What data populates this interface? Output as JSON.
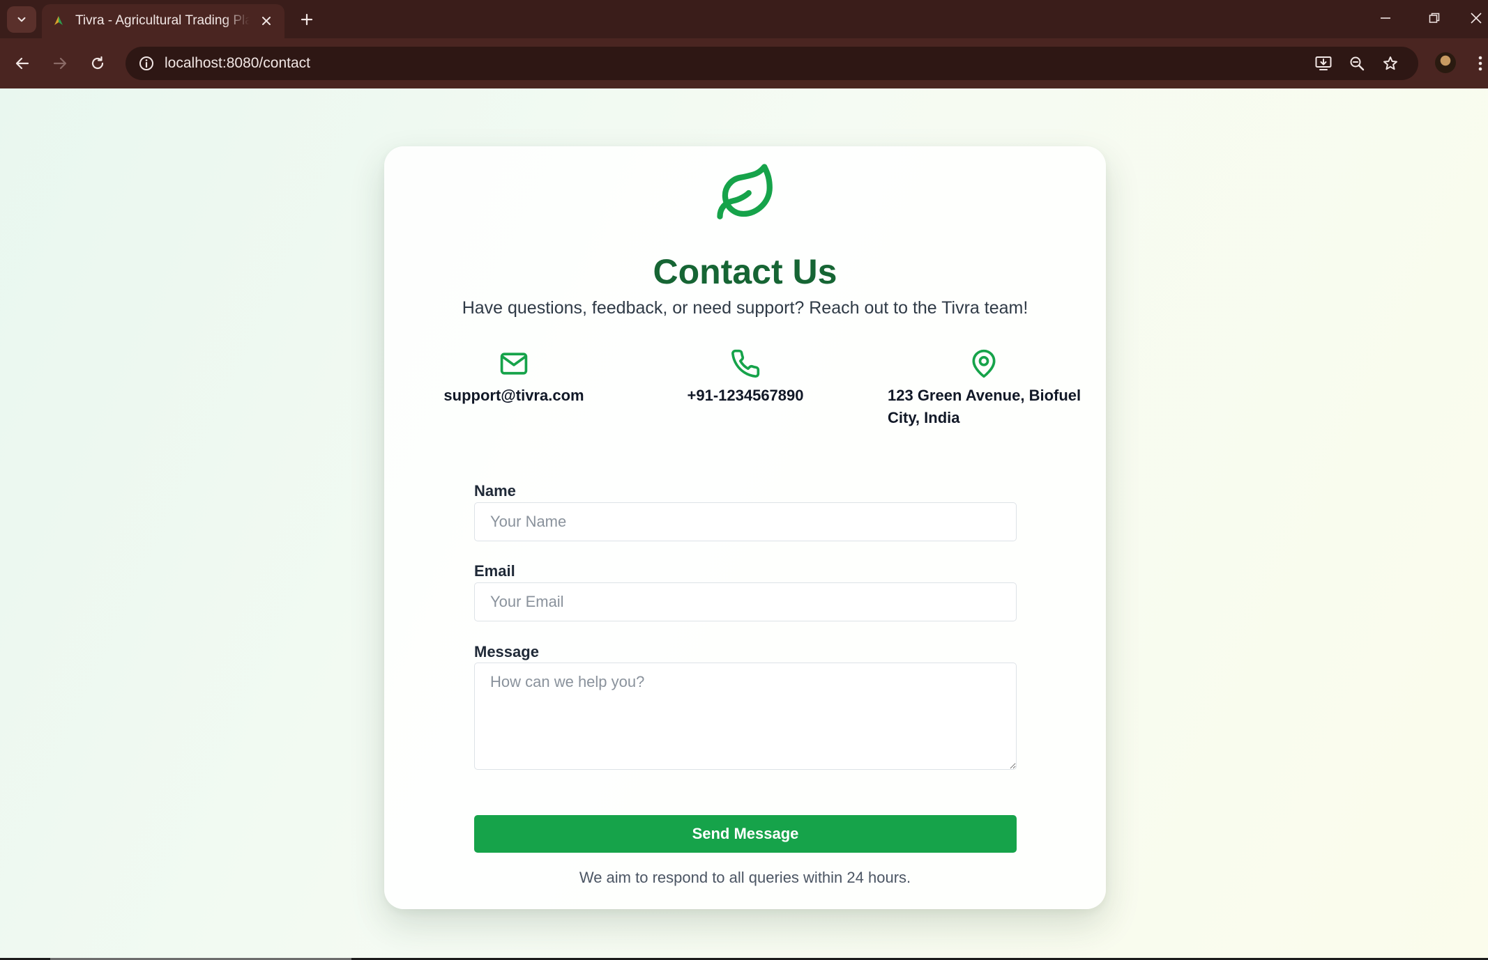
{
  "browser": {
    "tab_title": "Tivra - Agricultural Trading Platform",
    "url": "localhost:8080/contact"
  },
  "contact": {
    "title": "Contact Us",
    "subtitle": "Have questions, feedback, or need support? Reach out to the Tivra team!",
    "email": "support@tivra.com",
    "phone": "+91-1234567890",
    "address": "123 Green Avenue, Biofuel City, India",
    "icons": [
      "leaf-icon",
      "mail-icon",
      "phone-icon",
      "map-pin-icon"
    ]
  },
  "form": {
    "name_label": "Name",
    "name_placeholder": "Your Name",
    "email_label": "Email",
    "email_placeholder": "Your Email",
    "message_label": "Message",
    "message_placeholder": "How can we help you?",
    "submit_label": "Send Message"
  },
  "footer_note": "We aim to respond to all queries within 24 hours.",
  "colors": {
    "brand_green": "#166534",
    "accent_green": "#16a34a",
    "chrome_dark": "#3a1d1a",
    "chrome_toolbar": "#4a2521"
  }
}
